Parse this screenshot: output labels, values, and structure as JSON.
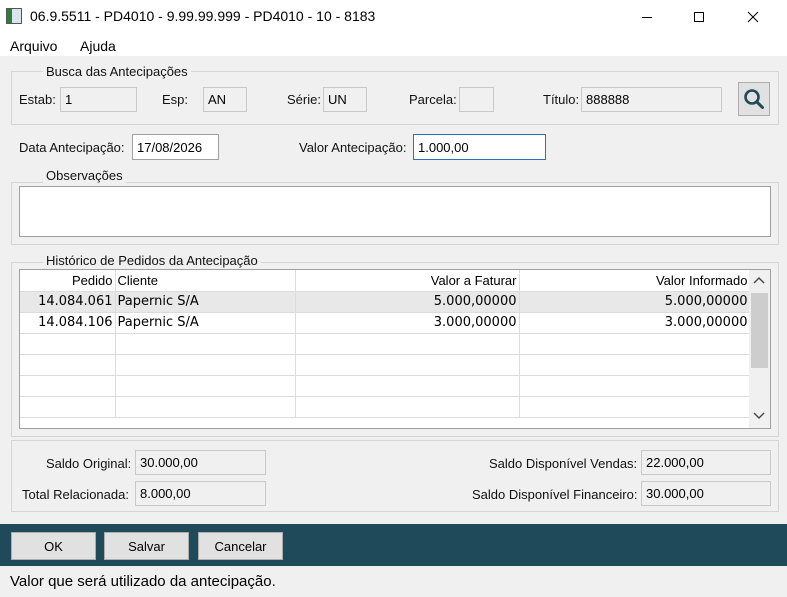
{
  "window": {
    "title": "06.9.5511 - PD4010 - 9.99.99.999 - PD4010 - 10 - 8183"
  },
  "menu": {
    "items": [
      "Arquivo",
      "Ajuda"
    ]
  },
  "busca": {
    "legend": "Busca das Antecipações",
    "estab_label": "Estab:",
    "estab_value": "1",
    "esp_label": "Esp:",
    "esp_value": "AN",
    "serie_label": "Série:",
    "serie_value": "UN",
    "parcela_label": "Parcela:",
    "parcela_value": "",
    "titulo_label": "Título:",
    "titulo_value": "888888",
    "search_icon": "magnifier-icon"
  },
  "antecipacao": {
    "data_label": "Data Antecipação:",
    "data_value": "17/08/2026",
    "valor_label": "Valor Antecipação:",
    "valor_value": "1.000,00"
  },
  "observacoes": {
    "legend": "Observações",
    "value": ""
  },
  "historico": {
    "legend": "Histórico de Pedidos da Antecipação",
    "columns": [
      "Pedido",
      "Cliente",
      "Valor a Faturar",
      "Valor Informado"
    ],
    "rows": [
      [
        "14.084.061",
        "Papernic S/A",
        "5.000,00000",
        "5.000,00000"
      ],
      [
        "14.084.106",
        "Papernic S/A",
        "3.000,00000",
        "3.000,00000"
      ]
    ]
  },
  "saldos": {
    "saldo_original_label": "Saldo Original:",
    "saldo_original_value": "30.000,00",
    "total_relacionada_label": "Total Relacionada:",
    "total_relacionada_value": "8.000,00",
    "saldo_vendas_label": "Saldo Disponível Vendas:",
    "saldo_vendas_value": "22.000,00",
    "saldo_financeiro_label": "Saldo Disponível Financeiro:",
    "saldo_financeiro_value": "30.000,00"
  },
  "buttons": {
    "ok": "OK",
    "salvar": "Salvar",
    "cancelar": "Cancelar"
  },
  "status": {
    "text": "Valor que será utilizado da antecipação."
  },
  "colors": {
    "button_bar": "#1f4a5a",
    "focus_border": "#2f6fbd",
    "selected_row": "#e8e8e8"
  }
}
